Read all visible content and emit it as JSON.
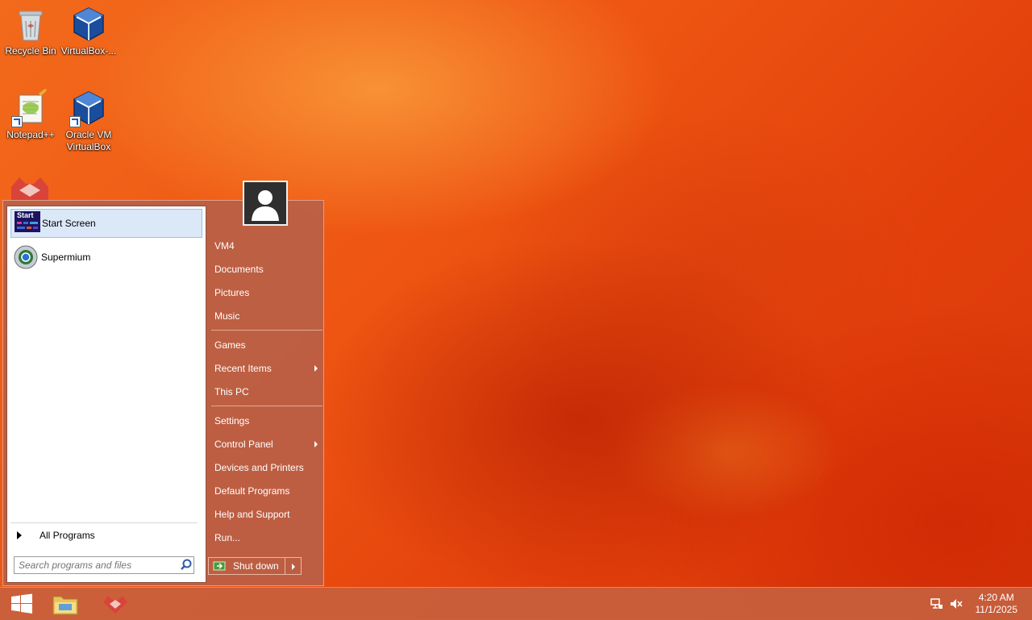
{
  "desktop": {
    "icons": [
      {
        "label": "Recycle Bin",
        "icon": "recycle-bin-icon"
      },
      {
        "label": "VirtualBox-...",
        "icon": "virtualbox-icon"
      },
      {
        "label": "Notepad++",
        "icon": "notepad-plus-plus-icon"
      },
      {
        "label": "Oracle VM VirtualBox",
        "icon": "virtualbox-icon"
      }
    ]
  },
  "start_menu": {
    "programs": [
      {
        "label": "Start Screen",
        "icon": "start-screen-icon",
        "badge": "Start"
      },
      {
        "label": "Supermium",
        "icon": "supermium-icon"
      }
    ],
    "all_programs": "All Programs",
    "search_placeholder": "Search programs and files",
    "right_items": [
      {
        "label": "VM4"
      },
      {
        "label": "Documents"
      },
      {
        "label": "Pictures"
      },
      {
        "label": "Music"
      },
      {
        "label": "Games"
      },
      {
        "label": "Recent Items",
        "submenu": true
      },
      {
        "label": "This PC"
      },
      {
        "label": "Settings"
      },
      {
        "label": "Control Panel",
        "submenu": true
      },
      {
        "label": "Devices and Printers"
      },
      {
        "label": "Default Programs"
      },
      {
        "label": "Help and Support"
      },
      {
        "label": "Run..."
      }
    ],
    "shutdown_label": "Shut down"
  },
  "taskbar": {
    "buttons": [
      "start-button-icon",
      "file-explorer-icon",
      "app-icon"
    ],
    "time": "4:20 AM",
    "date": "11/1/2025"
  },
  "colors": {
    "menu_panel": "#b86048",
    "selection": "#dbe8f8",
    "taskbar": "#c6603e"
  }
}
